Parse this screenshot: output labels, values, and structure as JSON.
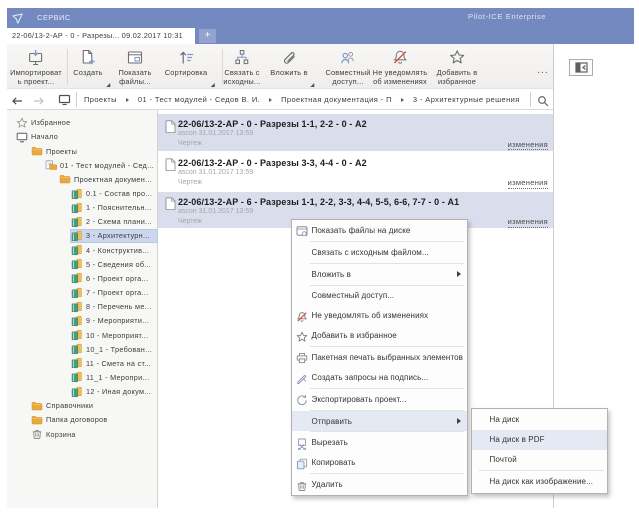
{
  "window": {
    "menu_label": "СЕРВИС",
    "title": "Pilot-ICE Enterprise"
  },
  "tabbar": {
    "active_tab": "22-06/13-2-АР - 0 - Разрезы... 09.02.2017 10:31",
    "new_tab_label": "+"
  },
  "ribbon": {
    "more_label": "...",
    "buttons": [
      {
        "label": "Импортироват\nь проект...",
        "icon": "import-project",
        "dropdown": false
      },
      {
        "label": "Создать",
        "icon": "create-doc",
        "dropdown": true
      },
      {
        "label": "Показать\nфайлы...",
        "icon": "show-files",
        "dropdown": false
      },
      {
        "label": "Сортировка",
        "icon": "sort",
        "dropdown": true
      },
      {
        "label": "Связать с\nисходны...",
        "icon": "link-source",
        "dropdown": false
      },
      {
        "label": "Вложить в",
        "icon": "attach",
        "dropdown": true
      },
      {
        "label": "Совместный\nдоступ...",
        "icon": "share-users",
        "dropdown": false
      },
      {
        "label": "Не уведомлять\nоб изменениях",
        "icon": "mute-bell",
        "dropdown": false
      },
      {
        "label": "Добавить в\nизбранное",
        "icon": "fav-star",
        "dropdown": false
      }
    ]
  },
  "breadcrumb": {
    "items": [
      {
        "label": "Проекты"
      },
      {
        "label": "01 - Тест модулей - Седов В. И."
      },
      {
        "label": "Проектная документация - П"
      },
      {
        "label": "3 - Архитектурные решения"
      }
    ]
  },
  "sidebar": {
    "items": [
      {
        "label": "Избранное",
        "icon": "star",
        "level": 0
      },
      {
        "label": "Начало",
        "icon": "monitor",
        "level": 0
      },
      {
        "label": "Проекты",
        "icon": "folder",
        "level": 1
      },
      {
        "label": "01 - Тест модулей - Сед...",
        "icon": "project",
        "level": 2
      },
      {
        "label": "Проектная докумен...",
        "icon": "folder",
        "level": 3
      },
      {
        "label": "0.1 - Состав про...",
        "icon": "section",
        "level": 4
      },
      {
        "label": "1 - Пояснительн...",
        "icon": "section",
        "level": 4
      },
      {
        "label": "2 - Схема плани...",
        "icon": "section",
        "level": 4
      },
      {
        "label": "3 - Архитектурн...",
        "icon": "section",
        "level": 4,
        "selected": true
      },
      {
        "label": "4 - Конструктив...",
        "icon": "section",
        "level": 4
      },
      {
        "label": "5 - Сведения об...",
        "icon": "section",
        "level": 4
      },
      {
        "label": "6 - Проект орга...",
        "icon": "section",
        "level": 4
      },
      {
        "label": "7 - Проект орга...",
        "icon": "section",
        "level": 4
      },
      {
        "label": "8 - Перечень ме...",
        "icon": "section",
        "level": 4
      },
      {
        "label": "9 - Мероприяти...",
        "icon": "section",
        "level": 4
      },
      {
        "label": "10 - Мероприят...",
        "icon": "section",
        "level": 4
      },
      {
        "label": "10_1 - Требован...",
        "icon": "section",
        "level": 4
      },
      {
        "label": "11 - Смета на ст...",
        "icon": "section",
        "level": 4
      },
      {
        "label": "11_1 - Меропри...",
        "icon": "section",
        "level": 4
      },
      {
        "label": "12 - Иная докум...",
        "icon": "section",
        "level": 4
      },
      {
        "label": "Справочники",
        "icon": "folder",
        "level": 1
      },
      {
        "label": "Папка договоров",
        "icon": "folder",
        "level": 1
      },
      {
        "label": "Корзина",
        "icon": "trash",
        "level": 1
      }
    ]
  },
  "list": {
    "rows": [
      {
        "title": "22-06/13-2-АР - 0 - Разрезы 1-1, 2-2 - 0 - А2",
        "meta": "ascon 31.01.2017 13:59",
        "type": "Чертеж",
        "link": "изменения",
        "selected": true
      },
      {
        "title": "22-06/13-2-АР - 0 - Разрезы 3-3, 4-4 - 0 - А2",
        "meta": "ascon 31.01.2017 13:59",
        "type": "Чертеж",
        "link": "изменения",
        "selected": false
      },
      {
        "title": "22-06/13-2-АР - 6 - Разрезы 1-1, 2-2, 3-3, 4-4, 5-5, 6-6, 7-7 - 0 - А1",
        "meta": "ascon 31.01.2017 13:59",
        "type": "Чертеж",
        "link": "изменения",
        "selected": true
      }
    ]
  },
  "context_menu": {
    "items": [
      {
        "label": "Показать файлы на диске",
        "icon": "mshow-files",
        "separator_after": true
      },
      {
        "label": "Связать с исходным файлом...",
        "separator_after": true
      },
      {
        "label": "Вложить в",
        "submenu": true,
        "separator_after": true
      },
      {
        "label": "Совместный доступ..."
      },
      {
        "label": "Не уведомлять об изменениях",
        "icon": "mbell"
      },
      {
        "label": "Добавить в избранное",
        "icon": "mstar",
        "separator_after": true
      },
      {
        "label": "Пакетная печать выбранных элементов",
        "icon": "mprinter"
      },
      {
        "label": "Создать запросы на подпись...",
        "icon": "mpen",
        "separator_after": true
      },
      {
        "label": "Экспортировать проект...",
        "icon": "mexport",
        "separator_after": true
      },
      {
        "label": "Отправить",
        "submenu": true,
        "highlighted": true,
        "separator_after": true
      },
      {
        "label": "Вырезать",
        "icon": "mcut"
      },
      {
        "label": "Копировать",
        "icon": "mcopy",
        "separator_after": true
      },
      {
        "label": "Удалить",
        "icon": "mtrash"
      }
    ]
  },
  "send_submenu": {
    "items": [
      {
        "label": "На диск"
      },
      {
        "label": "На диск в PDF",
        "highlighted": true
      },
      {
        "label": "Почтой",
        "separator_after": true
      },
      {
        "label": "На диск как изображение..."
      }
    ]
  },
  "colors": {
    "titlebar": "#7489bf",
    "selection_row": "#d9ddec",
    "selection_tree": "#ccd6ee",
    "menu_highlight": "#e4e9f4",
    "folder": "#e9a93e",
    "section_teal": "#4a9b80",
    "alert_red": "#d9463c"
  }
}
